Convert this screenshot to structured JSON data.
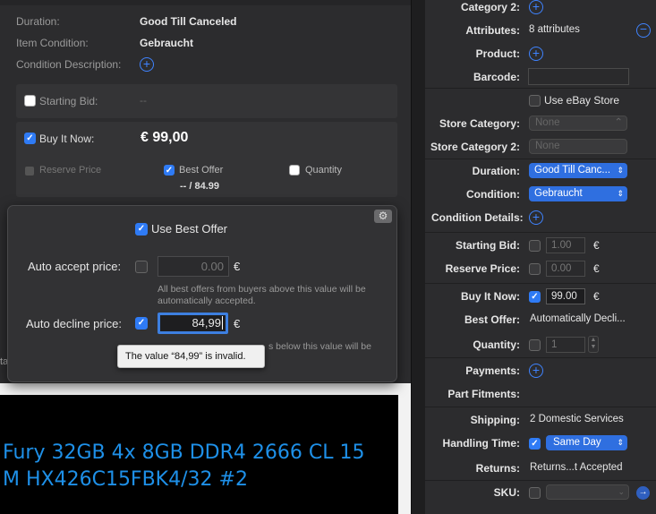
{
  "left": {
    "rows": [
      {
        "label": "Duration:",
        "value": "Good Till Canceled"
      },
      {
        "label": "Item Condition:",
        "value": "Gebraucht"
      },
      {
        "label": "Condition Description:"
      }
    ],
    "starting_bid": {
      "label": "Starting Bid:",
      "value": "--"
    },
    "buy_it_now": {
      "label": "Buy It Now:",
      "value": "€ 99,00"
    },
    "reserve_price": {
      "label": "Reserve Price"
    },
    "best_offer": {
      "label": "Best Offer",
      "summary": "-- / 84.99"
    },
    "quantity": {
      "label": "Quantity"
    },
    "cut_letter": "ta",
    "product_banner": {
      "line1": "Fury 32GB 4x 8GB DDR4 2666 CL 15",
      "line2": "M HX426C15FBK4/32 #2",
      "color": "#1e90e8"
    }
  },
  "popover": {
    "use_best_offer": "Use Best Offer",
    "auto_accept": {
      "label": "Auto accept price:",
      "value": "0.00",
      "currency": "€",
      "help": "All best offers from buyers above this value will be automatically accepted."
    },
    "auto_decline": {
      "label": "Auto decline price:",
      "value": "84,99",
      "currency": "€",
      "help_fragment": "s below this value will be"
    },
    "tooltip": "The value “84,99” is invalid."
  },
  "right": {
    "category2": "Category 2:",
    "attributes": {
      "label": "Attributes:",
      "value": "8 attributes"
    },
    "product": "Product:",
    "barcode": "Barcode:",
    "use_ebay_store": "Use eBay Store",
    "store_category": {
      "label": "Store Category:",
      "value": "None"
    },
    "store_category2": {
      "label": "Store Category 2:",
      "value": "None"
    },
    "duration": {
      "label": "Duration:",
      "value": "Good Till Canc..."
    },
    "condition": {
      "label": "Condition:",
      "value": "Gebraucht"
    },
    "condition_details": "Condition Details:",
    "starting_bid": {
      "label": "Starting Bid:",
      "value": "1.00",
      "currency": "€"
    },
    "reserve_price": {
      "label": "Reserve Price:",
      "value": "0.00",
      "currency": "€"
    },
    "buy_it_now": {
      "label": "Buy It Now:",
      "value": "99.00",
      "currency": "€"
    },
    "best_offer": {
      "label": "Best Offer:",
      "value": "Automatically Decli..."
    },
    "quantity": {
      "label": "Quantity:",
      "value": "1"
    },
    "payments": "Payments:",
    "part_fitments": "Part Fitments:",
    "shipping": {
      "label": "Shipping:",
      "value": "2 Domestic Services"
    },
    "handling_time": {
      "label": "Handling Time:",
      "value": "Same Day"
    },
    "returns": {
      "label": "Returns:",
      "value": "Returns...t Accepted"
    },
    "sku": "SKU:"
  },
  "colors": {
    "accent": "#2f7bf5",
    "background": "#2c2c2e",
    "banner_text": "#1e90e8"
  }
}
